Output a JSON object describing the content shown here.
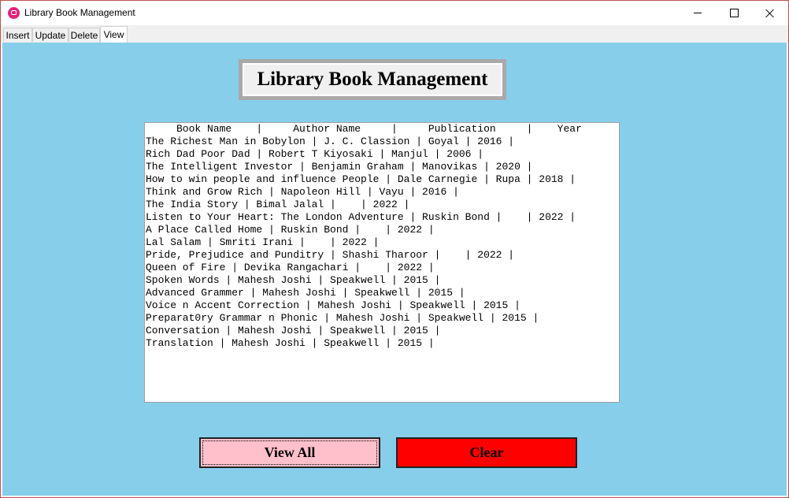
{
  "window": {
    "title": "Library Book Management"
  },
  "tabs": [
    {
      "label": "Insert"
    },
    {
      "label": "Update"
    },
    {
      "label": "Delete"
    },
    {
      "label": "View"
    }
  ],
  "heading": "Library Book Management",
  "list": {
    "header": "     Book Name    |     Author Name     |     Publication     |    Year",
    "rows": [
      "The Richest Man in Bobylon | J. C. Classion | Goyal | 2016 |",
      "Rich Dad Poor Dad | Robert T Kiyosaki | Manjul | 2006 |",
      "The Intelligent Investor | Benjamin Graham | Manovikas | 2020 |",
      "How to win people and influence People | Dale Carnegie | Rupa | 2018 |",
      "Think and Grow Rich | Napoleon Hill | Vayu | 2016 |",
      "The India Story | Bimal Jalal |    | 2022 |",
      "Listen to Your Heart: The London Adventure | Ruskin Bond |    | 2022 |",
      "A Place Called Home | Ruskin Bond |    | 2022 |",
      "Lal Salam | Smriti Irani |    | 2022 |",
      "Pride, Prejudice and Punditry | Shashi Tharoor |    | 2022 |",
      "Queen of Fire | Devika Rangachari |    | 2022 |",
      "Spoken Words | Mahesh Joshi | Speakwell | 2015 |",
      "Advanced Grammer | Mahesh Joshi | Speakwell | 2015 |",
      "Voice n Accent Correction | Mahesh Joshi | Speakwell | 2015 |",
      "Preparat0ry Grammar n Phonic | Mahesh Joshi | Speakwell | 2015 |",
      "Conversation | Mahesh Joshi | Speakwell | 2015 |",
      "Translation | Mahesh Joshi | Speakwell | 2015 |"
    ]
  },
  "buttons": {
    "view_all": "View All",
    "clear": "Clear"
  },
  "colors": {
    "background": "#87ceeb",
    "view_all_bg": "#ffc0cb",
    "clear_bg": "#ff0000",
    "app_icon": "#e2237c"
  }
}
